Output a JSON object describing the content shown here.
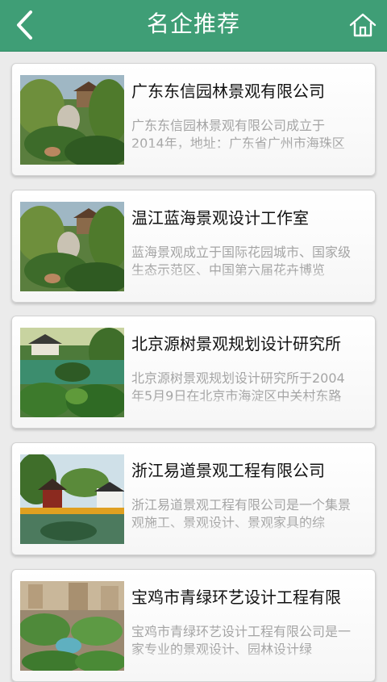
{
  "header": {
    "title": "名企推荐",
    "back_icon": "back-arrow-icon",
    "home_icon": "home-icon",
    "background": "#3f9e76"
  },
  "companies": [
    {
      "name": "广东东信园林景观有限公司",
      "desc": "广东东信园林景观有限公司成立于2014年，地址：广东省广州市海珠区"
    },
    {
      "name": "温江蓝海景观设计工作室",
      "desc": "蓝海景观成立于国际花园城市、国家级生态示范区、中国第六届花卉博览"
    },
    {
      "name": "北京源树景观规划设计研究所",
      "desc": "北京源树景观规划设计研究所于2004年5月9日在北京市海淀区中关村东路"
    },
    {
      "name": "浙江易道景观工程有限公司",
      "desc": "浙江易道景观工程有限公司是一个集景观施工、景观设计、景观家具的综"
    },
    {
      "name": "宝鸡市青绿环艺设计工程有限",
      "desc": "宝鸡市青绿环艺设计工程有限公司是一家专业的景观设计、园林设计绿"
    }
  ]
}
